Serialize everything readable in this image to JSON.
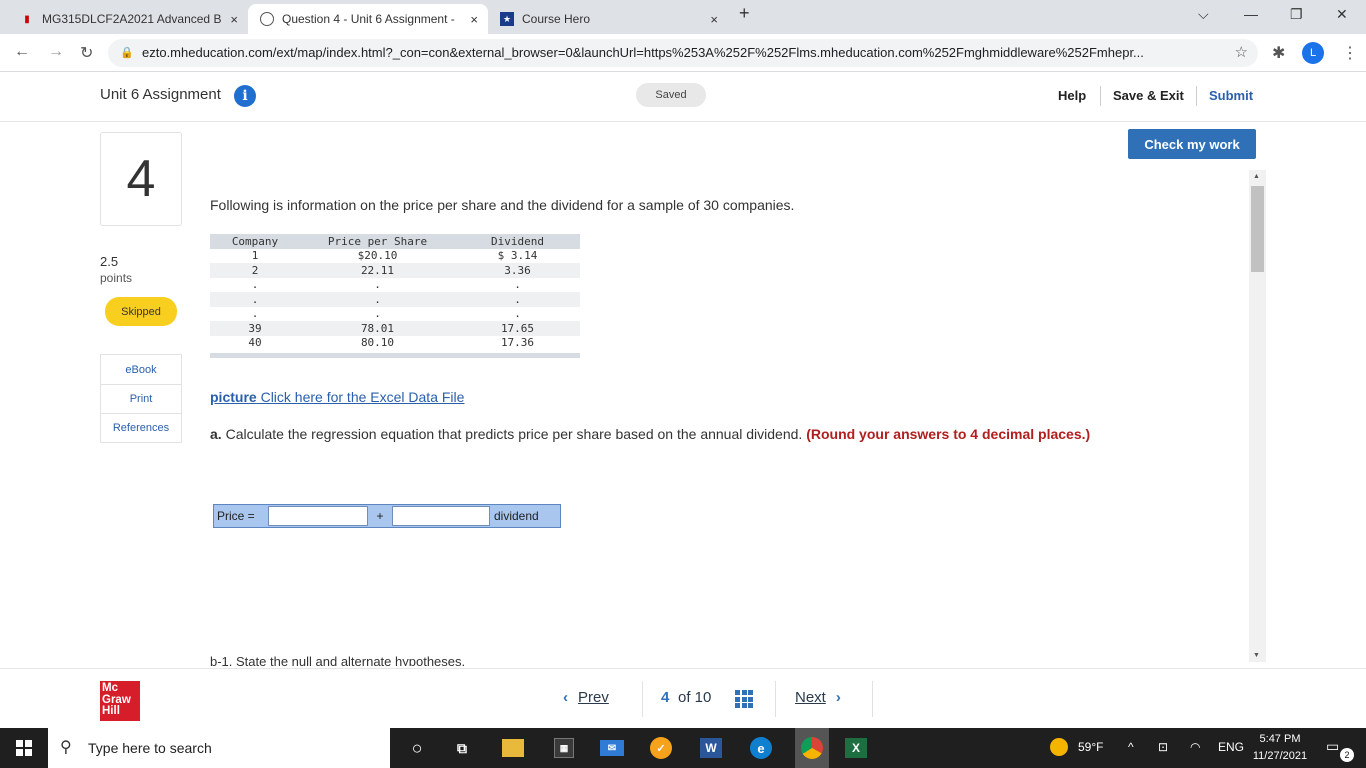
{
  "browser": {
    "tabs": [
      {
        "title": "MG315DLCF2A2021 Advanced B",
        "active": false,
        "close": "×"
      },
      {
        "title": "Question 4 - Unit 6 Assignment -",
        "active": true,
        "close": "×"
      },
      {
        "title": "Course Hero",
        "active": false,
        "close": "×"
      }
    ],
    "new_tab": "+",
    "url": "ezto.mheducation.com/ext/map/index.html?_con=con&external_browser=0&launchUrl=https%253A%252F%252Flms.mheducation.com%252Fmghmiddleware%252Fmhepr...",
    "profile_initial": "L"
  },
  "header": {
    "assignment_title": "Unit 6 Assignment",
    "info_glyph": "i",
    "saved_label": "Saved",
    "help_label": "Help",
    "save_exit_label": "Save & Exit",
    "submit_label": "Submit"
  },
  "question": {
    "number": "4",
    "points_value": "2.5",
    "points_label": "points",
    "status_badge": "Skipped",
    "resources": [
      "eBook",
      "Print",
      "References"
    ],
    "check_button": "Check my work",
    "intro": "Following is information on the price per share and the dividend for a sample of 30 companies.",
    "table": {
      "headers": [
        "Company",
        "Price per Share",
        "Dividend"
      ],
      "rows": [
        [
          "1",
          "$20.10",
          "$ 3.14"
        ],
        [
          "2",
          "22.11",
          "3.36"
        ],
        [
          ".",
          ".",
          "."
        ],
        [
          ".",
          ".",
          "."
        ],
        [
          ".",
          ".",
          "."
        ],
        [
          "39",
          "78.01",
          "17.65"
        ],
        [
          "40",
          "80.10",
          "17.36"
        ]
      ]
    },
    "excel_link": {
      "broken_image_text": "picture",
      "text": " Click here for the Excel Data File"
    },
    "part_a": {
      "label": "a.",
      "text": " Calculate the regression equation that predicts price per share based on the annual dividend. ",
      "instruction": "(Round your answers to 4 decimal places.)"
    },
    "equation": {
      "price_label": "Price =",
      "intercept_value": "",
      "plus": "+",
      "slope_value": "",
      "dividend_label": "dividend"
    },
    "next_part_text": "b-1. State the null and alternate hypotheses."
  },
  "footer": {
    "logo_lines": [
      "Mc",
      "Graw",
      "Hill"
    ],
    "prev_label": "Prev",
    "current_page": "4",
    "of_text": "of 10",
    "next_label": "Next"
  },
  "taskbar": {
    "search_placeholder": "Type here to search",
    "temperature": "59°F",
    "language": "ENG",
    "time": "5:47 PM",
    "date": "11/27/2021",
    "notification_count": "2"
  }
}
